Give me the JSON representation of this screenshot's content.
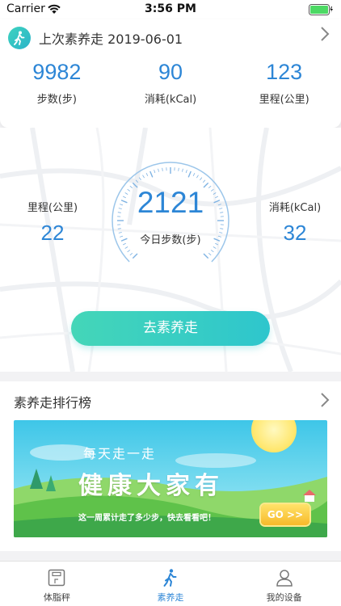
{
  "status_bar": {
    "carrier": "Carrier",
    "time": "3:56 PM"
  },
  "last_walk": {
    "title": "上次素养走 2019-06-01",
    "stats": [
      {
        "value": "9982",
        "label": "步数(步)"
      },
      {
        "value": "90",
        "label": "消耗(kCal)"
      },
      {
        "value": "123",
        "label": "里程(公里)"
      }
    ]
  },
  "today": {
    "distance_label": "里程(公里)",
    "distance_value": "22",
    "steps_value": "2121",
    "steps_label": "今日步数(步)",
    "calories_label": "消耗(kCal)",
    "calories_value": "32",
    "start_button": "去素养走"
  },
  "ranking": {
    "title": "素养走排行榜",
    "banner": {
      "line1": "每天走一走",
      "line2": "健康大家有",
      "line3": "这一周累计走了多少步，快去看看吧！",
      "go_label": "GO >>"
    }
  },
  "tabs": [
    {
      "label": "体脂秤",
      "icon": "scale-icon"
    },
    {
      "label": "素养走",
      "icon": "walker-icon"
    },
    {
      "label": "我的设备",
      "icon": "person-icon"
    }
  ],
  "colors": {
    "accent": "#2d86d6",
    "button": "#3ecfc3",
    "battery": "#4cd964"
  }
}
